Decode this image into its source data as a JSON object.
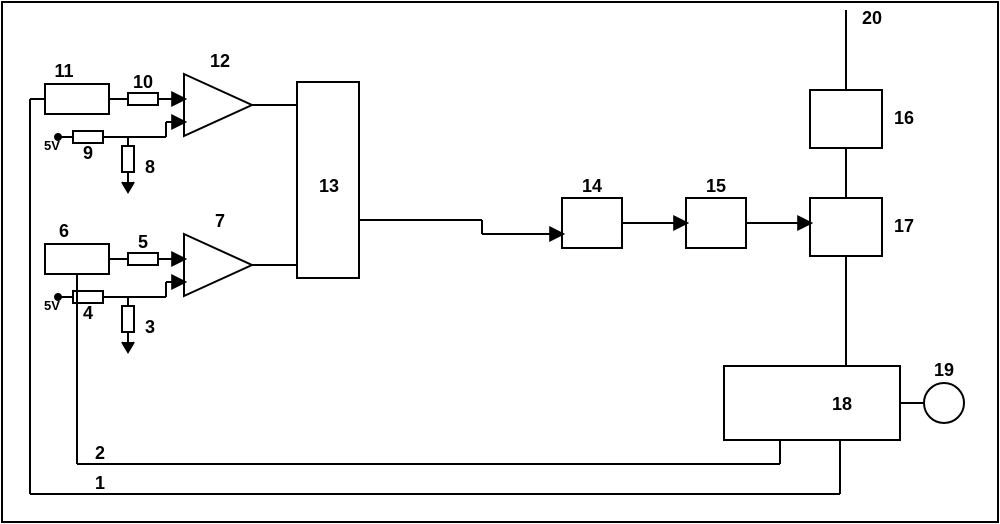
{
  "labels": {
    "n1": "1",
    "n2": "2",
    "n3": "3",
    "n4": "4",
    "n5": "5",
    "n6": "6",
    "n7": "7",
    "n8": "8",
    "n9": "9",
    "n10": "10",
    "n11": "11",
    "n12": "12",
    "n13": "13",
    "n14": "14",
    "n15": "15",
    "n16": "16",
    "n17": "17",
    "n18": "18",
    "n19": "19",
    "n20": "20"
  },
  "supplies": {
    "top": "5V",
    "bottom": "5V"
  }
}
